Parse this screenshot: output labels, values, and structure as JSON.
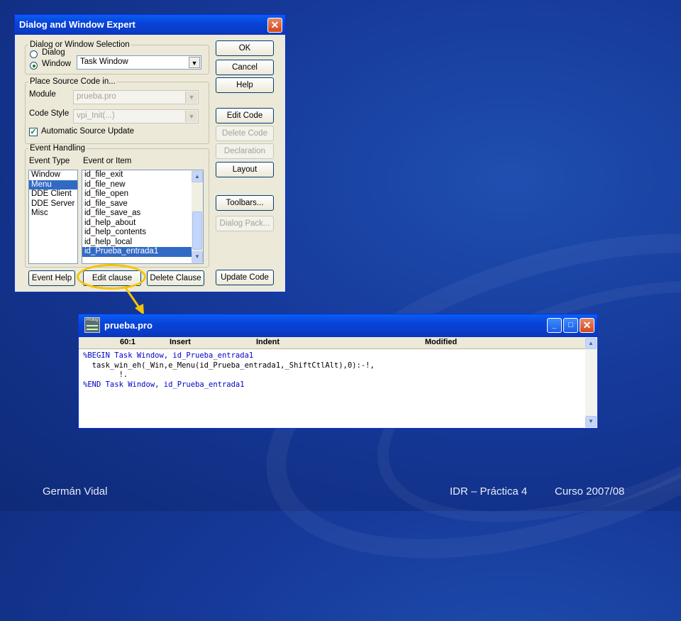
{
  "dialog": {
    "title": "Dialog and Window Expert",
    "selection_group": "Dialog or Window Selection",
    "radio_dialog": "Dialog",
    "radio_window": "Window",
    "window_combo_value": "Task Window",
    "place_group": "Place Source Code in...",
    "module_label": "Module",
    "module_value": "prueba.pro",
    "code_style_label": "Code Style",
    "code_style_value": "vpi_Init(...)",
    "auto_update_label": "Automatic Source Update",
    "event_group": "Event Handling",
    "event_type_label": "Event Type",
    "event_item_label": "Event or Item",
    "event_types": [
      "Window",
      "Menu",
      "DDE Client",
      "DDE Server",
      "Misc"
    ],
    "events": [
      "id_file_exit",
      "id_file_new",
      "id_file_open",
      "id_file_save",
      "id_file_save_as",
      "id_help_about",
      "id_help_contents",
      "id_help_local",
      "id_Prueba_entrada1"
    ],
    "buttons": {
      "ok": "OK",
      "cancel": "Cancel",
      "help": "Help",
      "edit_code": "Edit Code",
      "delete_code": "Delete Code",
      "declaration": "Declaration",
      "layout": "Layout",
      "toolbars": "Toolbars...",
      "dialog_pack": "Dialog Pack...",
      "event_help": "Event Help",
      "edit_clause": "Edit clause",
      "delete_clause": "Delete Clause",
      "update_code": "Update Code"
    }
  },
  "editor": {
    "title": "prueba.pro",
    "icon_text": "Prolog",
    "status": {
      "position": "60:1",
      "mode": "Insert",
      "indent": "Indent",
      "state": "Modified"
    },
    "code_lines": [
      "%BEGIN Task Window, id_Prueba_entrada1",
      "  task_win_eh(_Win,e_Menu(id_Prueba_entrada1,_ShiftCtlAlt),0):-!,",
      "        !.",
      "%END Task Window, id_Prueba_entrada1"
    ]
  },
  "footer": {
    "author": "Germán Vidal",
    "course_part": "IDR – Práctica 4",
    "year": "Curso 2007/08"
  },
  "colors": {
    "background": "#16399a",
    "highlight": "#f5c400",
    "selection": "#316ac5"
  }
}
